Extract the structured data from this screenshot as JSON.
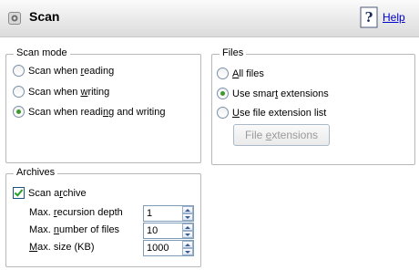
{
  "title": "Scan",
  "help_label": "Help",
  "scan_mode": {
    "legend": "Scan mode",
    "options": [
      {
        "pre": "Scan when ",
        "ul": "r",
        "post": "eading",
        "checked": false
      },
      {
        "pre": "Scan when ",
        "ul": "w",
        "post": "riting",
        "checked": false
      },
      {
        "pre": "Scan when readi",
        "ul": "n",
        "post": "g and writing",
        "checked": true
      }
    ]
  },
  "files": {
    "legend": "Files",
    "options": [
      {
        "pre": "",
        "ul": "A",
        "post": "ll files",
        "checked": false
      },
      {
        "pre": "Use smar",
        "ul": "t",
        "post": " extensions",
        "checked": true
      },
      {
        "pre": "",
        "ul": "U",
        "post": "se file extension list",
        "checked": false
      }
    ],
    "button": {
      "pre": "File ",
      "ul": "e",
      "post": "xtensions"
    }
  },
  "archives": {
    "legend": "Archives",
    "checkbox": {
      "pre": "Scan a",
      "ul": "r",
      "post": "chive",
      "checked": true
    },
    "fields": [
      {
        "pre": "Max. ",
        "ul": "r",
        "post": "ecursion depth",
        "value": "1"
      },
      {
        "pre": "Max. ",
        "ul": "n",
        "post": "umber of files",
        "value": "10"
      },
      {
        "pre": "",
        "ul": "M",
        "post": "ax. size (KB)",
        "value": "1000"
      }
    ]
  }
}
